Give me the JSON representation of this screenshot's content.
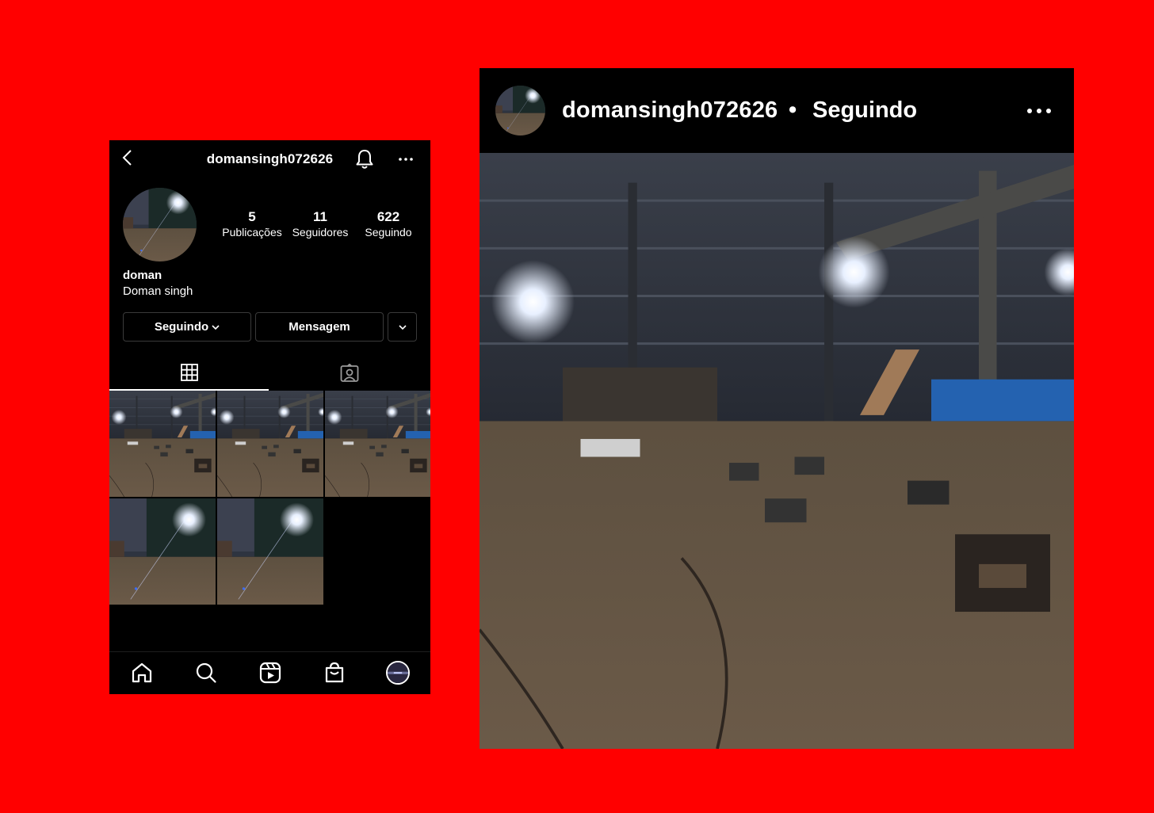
{
  "profile": {
    "username": "domansingh072626",
    "display_name": "doman",
    "full_name": "Doman singh",
    "stats": {
      "posts": {
        "count": "5",
        "label": "Publicações"
      },
      "followers": {
        "count": "11",
        "label": "Seguidores"
      },
      "following": {
        "count": "622",
        "label": "Seguindo"
      }
    },
    "buttons": {
      "following_label": "Seguindo",
      "message_label": "Mensagem"
    },
    "tabs": [
      "grid-icon",
      "tagged-icon"
    ],
    "active_tab": "grid",
    "icons": {
      "back": "back-arrow-icon",
      "notifications": "bell-icon",
      "more": "more-dots-icon"
    }
  },
  "bottom_nav": {
    "items": [
      "home-icon",
      "search-icon",
      "reels-icon",
      "shop-icon",
      "profile-avatar"
    ]
  },
  "post": {
    "username": "domansingh072626",
    "separator": "•",
    "following_label": "Seguindo",
    "more_icon": "more-dots-icon"
  },
  "colors": {
    "background": "#ff0000",
    "panel": "#000000",
    "text": "#ffffff",
    "button_border": "#3a3a3a"
  }
}
